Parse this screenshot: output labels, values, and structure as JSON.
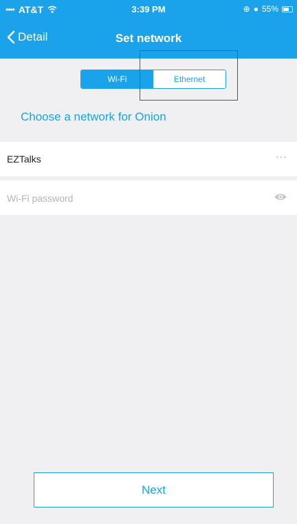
{
  "status_bar": {
    "signal": "••••",
    "carrier": "AT&T",
    "time": "3:39 PM",
    "battery_pct": "55%"
  },
  "nav": {
    "back_label": "Detail",
    "title": "Set network"
  },
  "segments": {
    "wifi_label": "Wi-Fi",
    "ethernet_label": "Ethernet",
    "selected": "Wi-Fi"
  },
  "section": {
    "heading": "Choose a network for Onion"
  },
  "network": {
    "name": "EZTalks"
  },
  "password": {
    "placeholder": "Wi-Fi password",
    "value": ""
  },
  "actions": {
    "next_label": "Next"
  },
  "icons": {
    "back": "chevron-left-icon",
    "more": "ellipsis-icon",
    "eye": "eye-icon",
    "wifi": "wifi-icon",
    "battery": "battery-icon"
  },
  "colors": {
    "accent": "#1aa3ea",
    "background": "#f0f0f2",
    "highlight": "#e01a1a"
  }
}
